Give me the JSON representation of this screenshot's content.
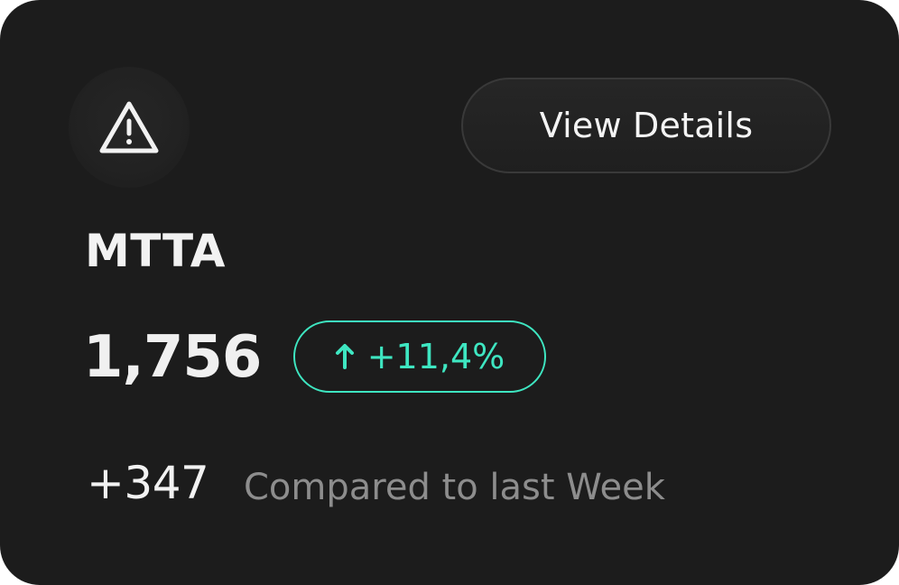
{
  "card": {
    "button_label": "View Details",
    "metric_title": "MTTA",
    "metric_value": "1,756",
    "change": {
      "direction": "up",
      "value": "+11,4%",
      "color": "#3ee6c1"
    },
    "delta": "+347",
    "comparison_text": "Compared to last Week",
    "icon": "warning-triangle-icon"
  },
  "colors": {
    "card_background": "#1c1c1c",
    "primary_text": "#f2f2f2",
    "secondary_text": "#8d8d8d",
    "accent": "#3ee6c1"
  }
}
